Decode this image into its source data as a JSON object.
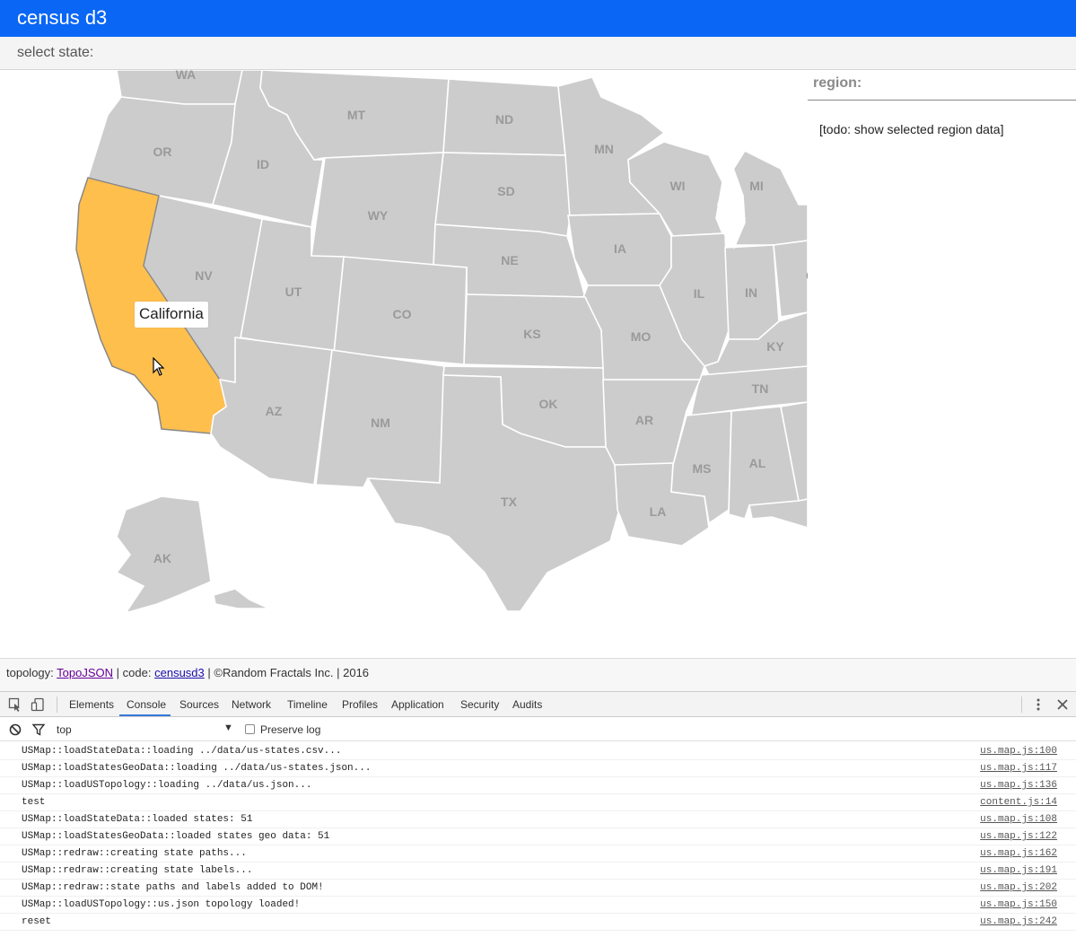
{
  "app": {
    "title": "census d3"
  },
  "select": {
    "label": "select state:"
  },
  "map": {
    "selected_state": "California",
    "tooltip": "California",
    "selected_color": "#ffbf4d",
    "default_color": "#cccccc",
    "labels": [
      "WA",
      "OR",
      "ID",
      "MT",
      "ND",
      "MN",
      "WI",
      "MI",
      "SD",
      "WY",
      "NV",
      "UT",
      "CO",
      "NE",
      "IA",
      "IL",
      "IN",
      "KY",
      "KS",
      "MO",
      "TN",
      "OK",
      "AR",
      "AZ",
      "NM",
      "TX",
      "MS",
      "AL",
      "LA",
      "AK",
      "O"
    ]
  },
  "region": {
    "heading": "region:",
    "body": "[todo: show selected region data]"
  },
  "footer": {
    "topology_prefix": "topology:",
    "topology_link": "TopoJSON",
    "sep1": "|",
    "code_prefix": "code:",
    "code_link": "censusd3",
    "tail": "| ©Random Fractals Inc. | 2016"
  },
  "devtools": {
    "tabs": [
      "Elements",
      "Console",
      "Sources",
      "Network",
      "Timeline",
      "Profiles",
      "Application",
      "Security",
      "Audits"
    ],
    "active_tab": "Console",
    "context": "top",
    "preserve_log_label": "Preserve log",
    "preserve_log_checked": false,
    "accent": "#3879d9",
    "log": [
      {
        "message": "USMap::loadStateData::loading ../data/us-states.csv...",
        "source": "us.map.js:100"
      },
      {
        "message": "USMap::loadStatesGeoData::loading ../data/us-states.json...",
        "source": "us.map.js:117"
      },
      {
        "message": "USMap::loadUSTopology::loading ../data/us.json...",
        "source": "us.map.js:136"
      },
      {
        "message": "test",
        "source": "content.js:14"
      },
      {
        "message": "USMap::loadStateData::loaded states: 51",
        "source": "us.map.js:108"
      },
      {
        "message": "USMap::loadStatesGeoData::loaded states geo data: 51",
        "source": "us.map.js:122"
      },
      {
        "message": "USMap::redraw::creating state paths...",
        "source": "us.map.js:162"
      },
      {
        "message": "USMap::redraw::creating state labels...",
        "source": "us.map.js:191"
      },
      {
        "message": "USMap::redraw::state paths and labels added to DOM!",
        "source": "us.map.js:202"
      },
      {
        "message": "USMap::loadUSTopology::us.json topology loaded!",
        "source": "us.map.js:150"
      },
      {
        "message": "reset",
        "source": "us.map.js:242"
      }
    ]
  }
}
